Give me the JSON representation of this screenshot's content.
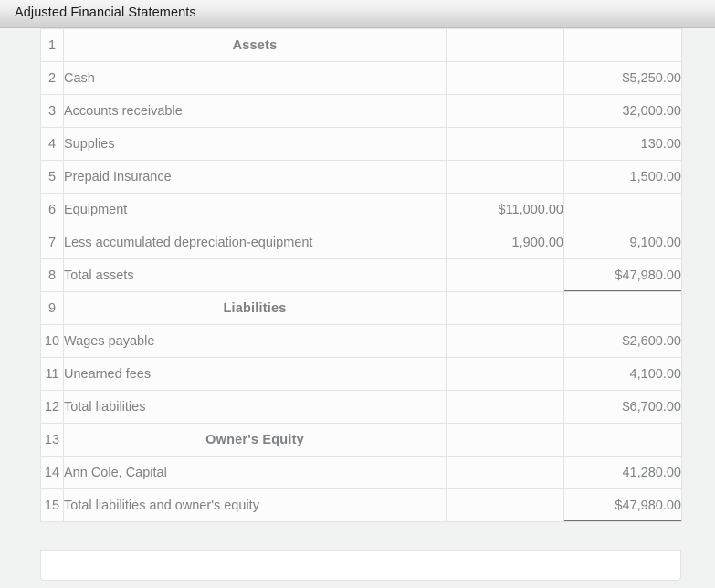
{
  "window": {
    "title": "Adjusted Financial Statements"
  },
  "sheet": {
    "columns": [
      "row",
      "account",
      "amount_1",
      "amount_2"
    ],
    "rows": [
      {
        "num": "1",
        "label": "Assets",
        "mid": "",
        "val": "",
        "kind": "section"
      },
      {
        "num": "2",
        "label": "Cash",
        "mid": "",
        "val": "$5,250.00",
        "kind": "item"
      },
      {
        "num": "3",
        "label": "Accounts receivable",
        "mid": "",
        "val": "32,000.00",
        "kind": "item"
      },
      {
        "num": "4",
        "label": "Supplies",
        "mid": "",
        "val": "130.00",
        "kind": "item"
      },
      {
        "num": "5",
        "label": "Prepaid Insurance",
        "mid": "",
        "val": "1,500.00",
        "kind": "item"
      },
      {
        "num": "6",
        "label": "Equipment",
        "mid": "$11,000.00",
        "val": "",
        "kind": "item"
      },
      {
        "num": "7",
        "label": "Less accumulated depreciation-equipment",
        "mid": "1,900.00",
        "val": "9,100.00",
        "kind": "item-indent-subtotal"
      },
      {
        "num": "8",
        "label": "Total assets",
        "mid": "",
        "val": "$47,980.00",
        "kind": "total-double"
      },
      {
        "num": "9",
        "label": "Liabilities",
        "mid": "",
        "val": "",
        "kind": "section"
      },
      {
        "num": "10",
        "label": "Wages payable",
        "mid": "",
        "val": "$2,600.00",
        "kind": "item"
      },
      {
        "num": "11",
        "label": "Unearned fees",
        "mid": "",
        "val": "4,100.00",
        "kind": "item-subtotal"
      },
      {
        "num": "12",
        "label": "Total liabilities",
        "mid": "",
        "val": "$6,700.00",
        "kind": "total"
      },
      {
        "num": "13",
        "label": "Owner's Equity",
        "mid": "",
        "val": "",
        "kind": "section"
      },
      {
        "num": "14",
        "label": "Ann Cole, Capital",
        "mid": "",
        "val": "41,280.00",
        "kind": "item-subtotal"
      },
      {
        "num": "15",
        "label": "Total liabilities and owner's equity",
        "mid": "",
        "val": "$47,980.00",
        "kind": "total-double"
      }
    ]
  },
  "colors": {
    "text": "#7d8184",
    "rule": "#6d6f71",
    "grid": "#e3e3e3",
    "row_header_bg": "#f4f4f4",
    "cell_bg": "#fcfcfc",
    "canvas_bg": "#f1f2f2",
    "title_text": "#1b1b1b"
  }
}
